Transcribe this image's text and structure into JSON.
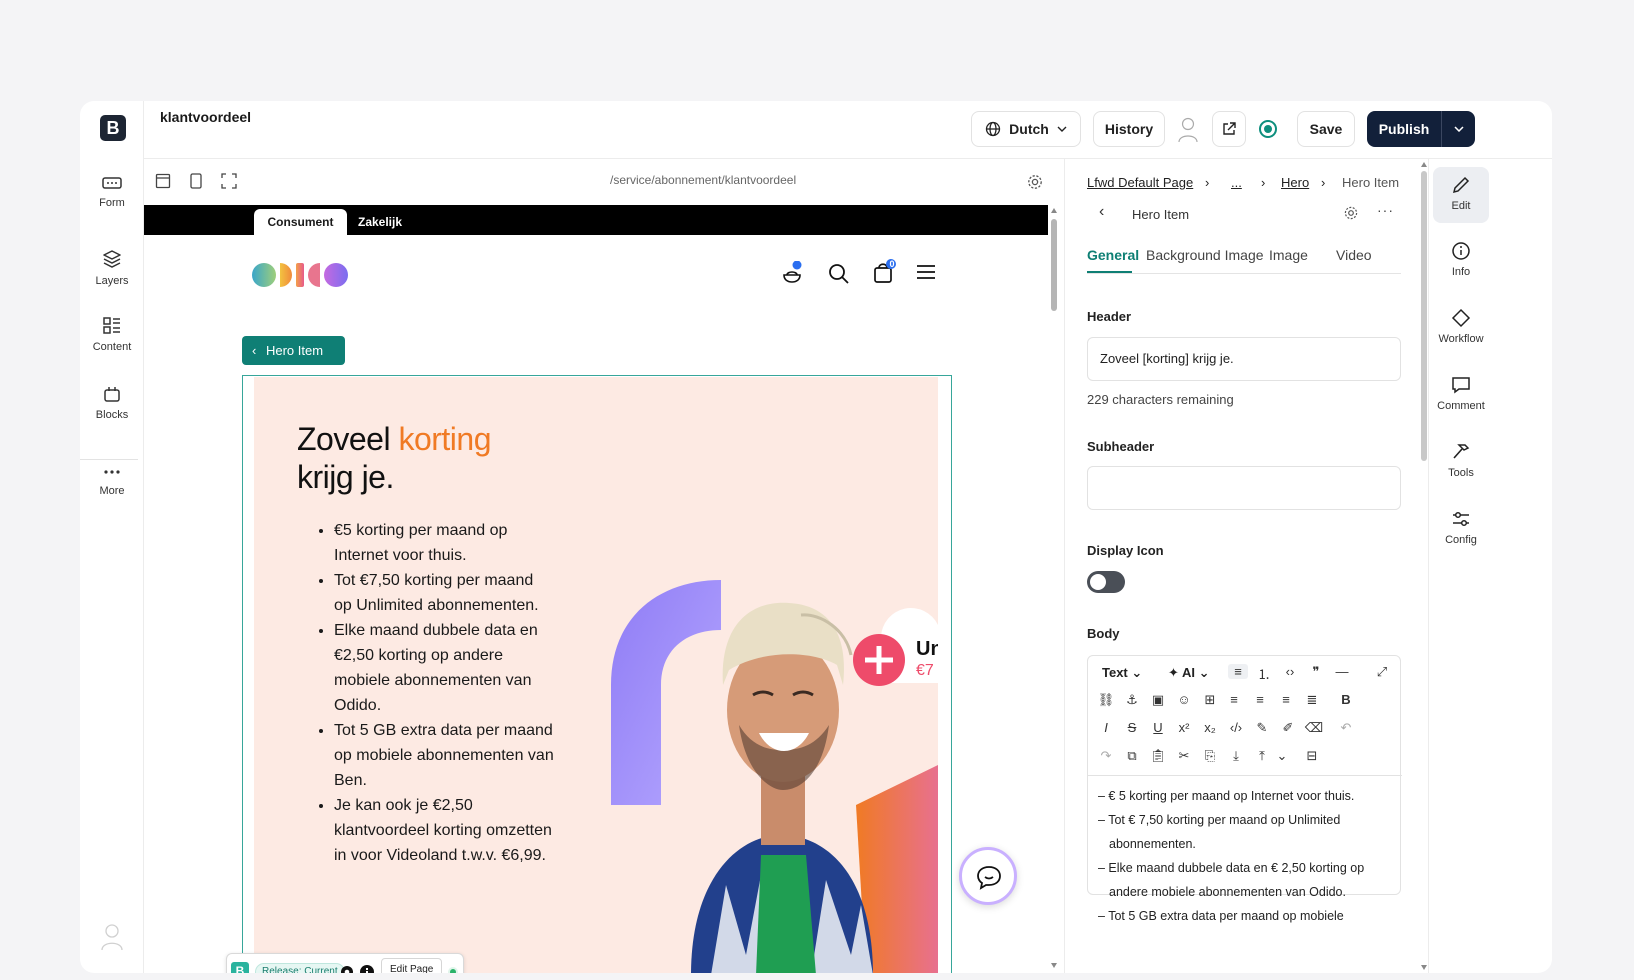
{
  "app": {
    "page_name": "klantvoordeel"
  },
  "left_rail": {
    "items": [
      {
        "label": "Form",
        "icon": "form-icon"
      },
      {
        "label": "Layers",
        "icon": "layers-icon"
      },
      {
        "label": "Content",
        "icon": "content-icon"
      },
      {
        "label": "Blocks",
        "icon": "blocks-icon"
      },
      {
        "label": "More",
        "icon": "more-icon"
      }
    ]
  },
  "header": {
    "language": "Dutch",
    "history": "History",
    "save": "Save",
    "publish": "Publish"
  },
  "preview": {
    "url": "/service/abonnement/klantvoordeel",
    "site_tabs": [
      "Consument",
      "Zakelijk"
    ],
    "cart_badge": "0",
    "hero_chip": "Hero Item",
    "hero_title_a": "Zoveel ",
    "hero_title_accent": "korting",
    "hero_title_b": "krijg je.",
    "hero_bullets": [
      "€5 korting per maand op Internet voor thuis.",
      "Tot €7,50 korting per maand op Unlimited abonnementen.",
      "Elke maand dubbele data en €2,50 korting op andere mobiele abonnementen van Odido.",
      "Tot 5 GB extra data per maand op mobiele abonnementen van Ben.",
      "Je kan ook je €2,50 klantvoordeel korting omzetten in voor Videoland t.w.v. €6,99."
    ],
    "promo_text": "Un",
    "promo_sub": "€7",
    "accent_color": "#f07a24"
  },
  "float_toolbar": {
    "release": "Release: Current",
    "edit_page": "Edit Page"
  },
  "panel": {
    "breadcrumb": [
      "Lfwd Default Page",
      "...",
      "Hero",
      "Hero Item"
    ],
    "title": "Hero Item",
    "tabs": [
      "General",
      "Background Image",
      "Image",
      "Video"
    ],
    "header_label": "Header",
    "header_value": "Zoveel [korting] krijg je.",
    "remaining": "229 characters remaining",
    "subheader_label": "Subheader",
    "subheader_value": "",
    "display_icon_label": "Display Icon",
    "display_icon_on": false,
    "body_label": "Body",
    "editor_text_menu": "Text",
    "editor_ai_menu": "AI",
    "body_lines": [
      "– € 5 korting per maand op Internet voor thuis.",
      "– Tot € 7,50 korting per maand op Unlimited abonnementen.",
      "– Elke maand dubbele data en € 2,50 korting op andere mobiele abonnementen van Odido.",
      "– Tot 5 GB extra data per maand op mobiele"
    ]
  },
  "right_rail": {
    "items": [
      {
        "label": "Edit",
        "icon": "pencil-icon"
      },
      {
        "label": "Info",
        "icon": "info-icon"
      },
      {
        "label": "Workflow",
        "icon": "diamond-icon"
      },
      {
        "label": "Comment",
        "icon": "comment-icon"
      },
      {
        "label": "Tools",
        "icon": "hammer-icon"
      },
      {
        "label": "Config",
        "icon": "sliders-icon"
      }
    ]
  }
}
